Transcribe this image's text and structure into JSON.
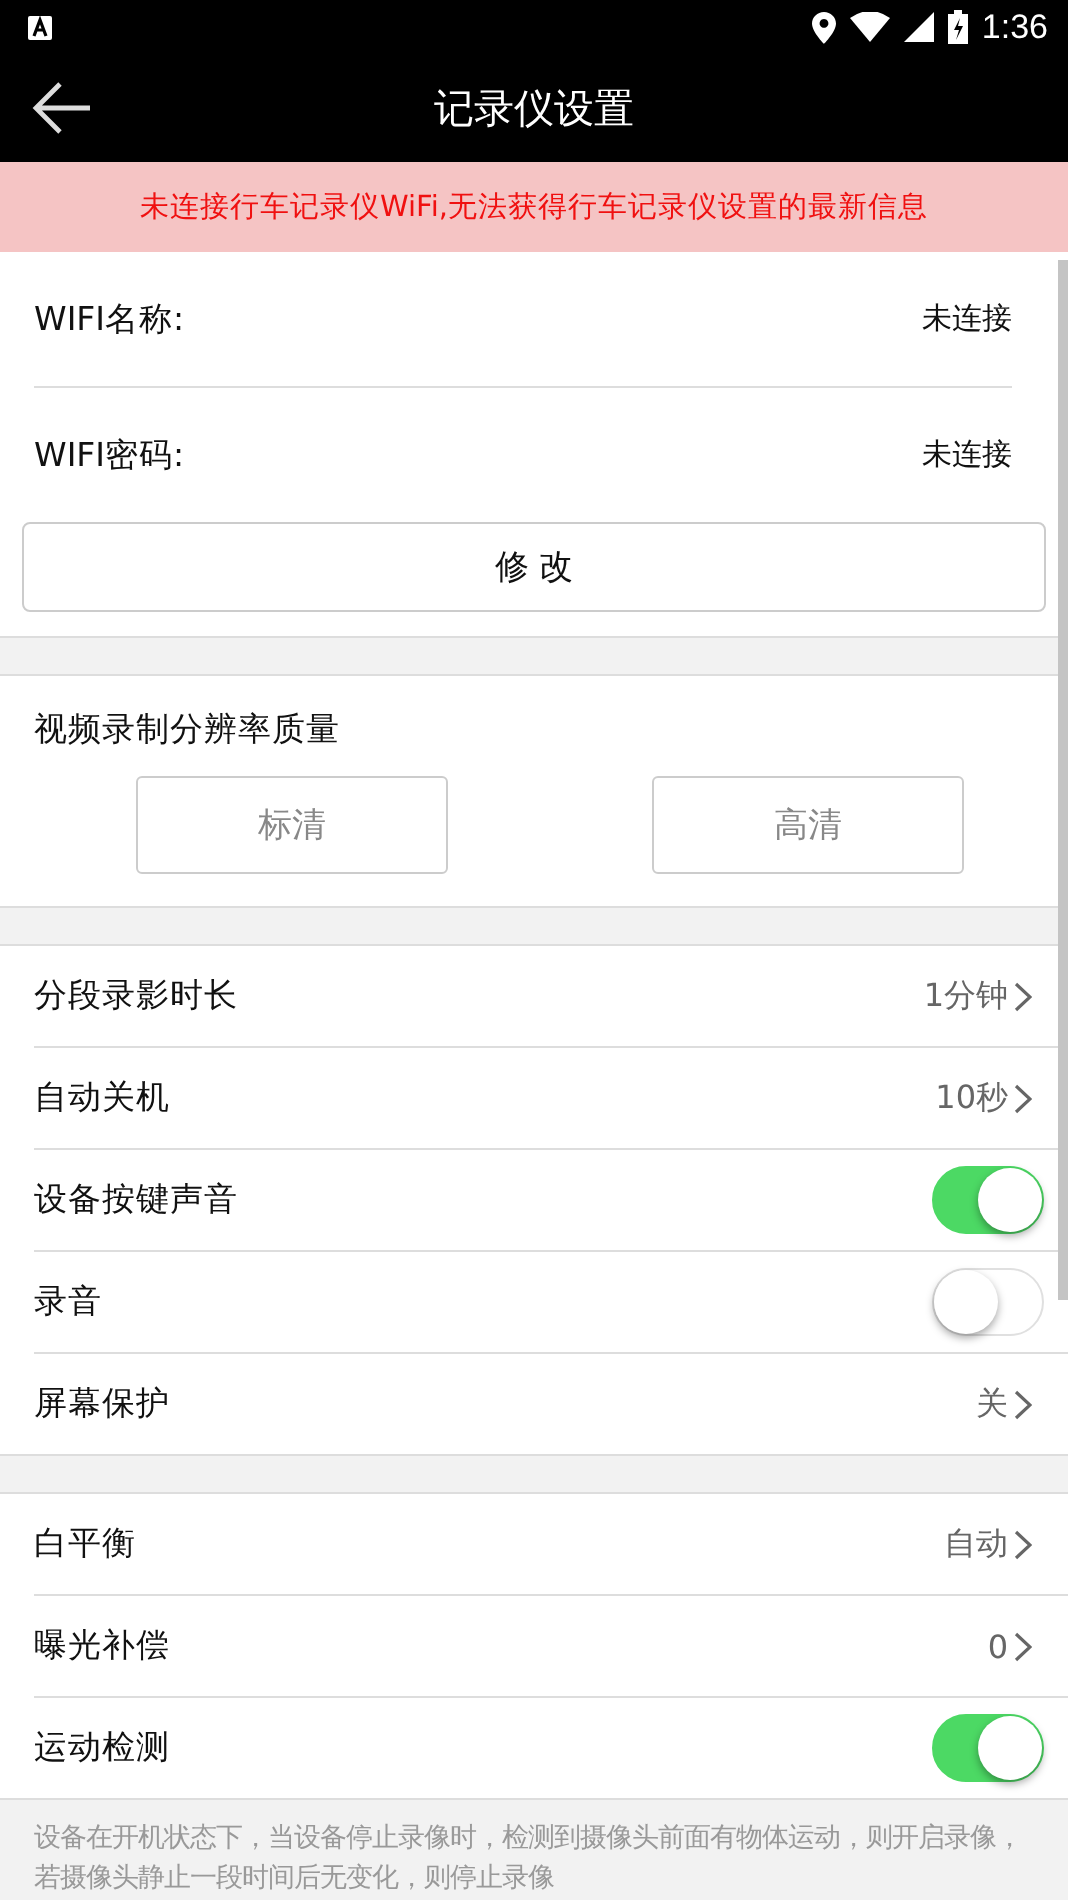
{
  "status_bar": {
    "time": "1:36"
  },
  "toolbar": {
    "title": "记录仪设置"
  },
  "banner": {
    "text": "未连接行车记录仪WiFi,无法获得行车记录仪设置的最新信息"
  },
  "wifi": {
    "fields": [
      {
        "label": "WIFI名称:",
        "value": "未连接"
      },
      {
        "label": "WIFI密码:",
        "value": "未连接"
      }
    ],
    "button": "修 改"
  },
  "resolution": {
    "title": "视频录制分辨率质量",
    "options": [
      {
        "label": "标清",
        "selected": false
      },
      {
        "label": "高清",
        "selected": false
      }
    ]
  },
  "groups": [
    {
      "items": [
        {
          "kind": "value",
          "label": "分段录影时长",
          "value": "1分钟"
        },
        {
          "kind": "value",
          "label": "自动关机",
          "value": "10秒"
        },
        {
          "kind": "toggle",
          "label": "设备按键声音",
          "on": true
        },
        {
          "kind": "toggle",
          "label": "录音",
          "on": false
        },
        {
          "kind": "value",
          "label": "屏幕保护",
          "value": "关"
        }
      ]
    },
    {
      "items": [
        {
          "kind": "value",
          "label": "白平衡",
          "value": "自动"
        },
        {
          "kind": "value",
          "label": "曝光补偿",
          "value": "0"
        },
        {
          "kind": "toggle",
          "label": "运动检测",
          "on": true
        }
      ]
    }
  ],
  "footnote": "设备在开机状态下，当设备停止录像时，检测到摄像头前面有物体运动，则开启录像，若摄像头静止一段时间后无变化，则停止录像"
}
